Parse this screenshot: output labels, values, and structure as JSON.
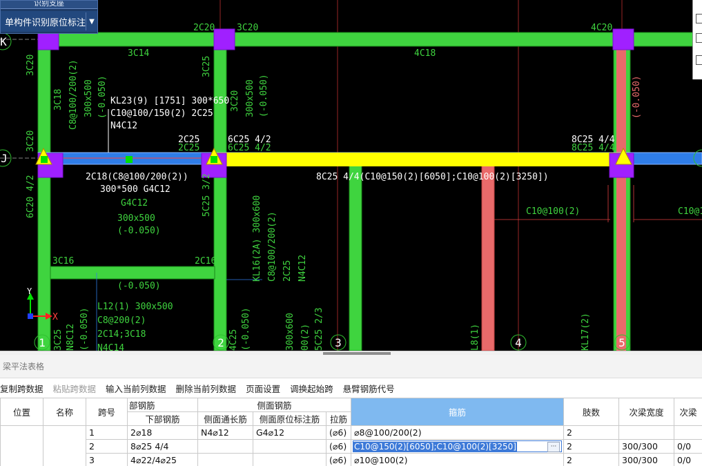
{
  "command_panel": {
    "top_label": "识别支座",
    "main_label": "单构件识别原位标注",
    "dropdown_icon": "chevron-down-icon"
  },
  "cad": {
    "axes": {
      "K": "K",
      "J": "J",
      "a1": "1",
      "a2": "2",
      "a3": "3",
      "a4": "4",
      "a5": "5"
    },
    "beam_info": {
      "line1": "KL23(9) [1751] 300*650",
      "line2": "C10@100/150(2) 2C25",
      "line3": "N4C12"
    },
    "labels": {
      "t_2c20": "2C20",
      "t_3c20": "3C20",
      "t_4c20": "4C20",
      "t_3c14": "3C14",
      "t_4c18": "4C18",
      "t_2c25_top": "2C25",
      "t_2c25_bot": "2C25",
      "t_6c25": "6C25 4/2",
      "t_6c25b": "6C25 4/2",
      "t_8c25": "8C25 4/4",
      "t_8c25b": "8C25 4/4",
      "t_orig_span1": "2C18(C8@100/200(2))",
      "t_size1": "300*500 G4C12",
      "t_orig_span2": "8C25 4/4(C10@150(2)[6050];C10@100(2)[3250])",
      "t_g4c12": "G4C12",
      "t_300x500": "300x500",
      "t_elev1": "(-0.050)",
      "t_3c16": "3C16",
      "t_2c16": "2C16",
      "t_elev2": "(-0.050)",
      "t_l12": "L12(1) 300x500",
      "t_c8at200": "C8@200(2)",
      "t_2c14": "2C14;3C18",
      "t_n4c14": "N4C14",
      "t_c10at100_1": "C10@100(2)",
      "t_c10at100_2": "C10@100(2",
      "t_v_3c18": "3C18",
      "t_v_c8": "C8@100/200(2)",
      "t_v_300x500": "300x500",
      "t_v_elev": "(-0.050)",
      "t_v_3c25": "3C25",
      "t_v_3c20": "3C20",
      "t_v_6c20": "6C20 4/2",
      "t_v_3c20b": "3C20",
      "t_v_300b": "300x500",
      "t_v_elevb": "(-0.050)",
      "t_v_elevc": "(-0.050)",
      "t_v_5c25": "5C25 3/2",
      "t_v_kl16": "KL16(2A) 300x600",
      "t_v_c8b": "C8@100/200(2)",
      "t_v_2c25": "2C25",
      "t_v_n4c12": "N4C12",
      "t_v_300x600": "300x600",
      "t_v_00_2": "00(2)",
      "t_v_5c25b": "5C25 2/3",
      "t_v_3c25b": "3C25",
      "t_v_n8c12": "N8C12",
      "t_v_elevd": "(-0.050)",
      "t_v_4c25": "4C25",
      "t_v_l8": "L8(1)",
      "t_v_kl17": "KL17(2)",
      "axis_x": "X",
      "axis_y": "Y"
    }
  },
  "panel": {
    "title": "梁平法表格",
    "toolbar": [
      {
        "label": "复制跨数据",
        "disabled": false
      },
      {
        "label": "粘贴跨数据",
        "disabled": true
      },
      {
        "label": "输入当前列数据",
        "disabled": false
      },
      {
        "label": "删除当前列数据",
        "disabled": false
      },
      {
        "label": "页面设置",
        "disabled": false
      },
      {
        "label": "调换起始跨",
        "disabled": false
      },
      {
        "label": "悬臂钢筋代号",
        "disabled": false
      }
    ],
    "headers": {
      "pos": "位置",
      "name": "名称",
      "span": "跨号",
      "group_bottom": "部钢筋",
      "bottom": "下部钢筋",
      "group_side": "侧面钢筋",
      "side_through": "侧面通长筋",
      "side_local": "侧面原位标注筋",
      "tie": "拉筋",
      "stirrup": "箍筋",
      "legs": "肢数",
      "sec_width": "次梁宽度",
      "sec_more": "次梁"
    },
    "rows": [
      {
        "span": "1",
        "bottom": "2⌀18",
        "side_through": "N4⌀12",
        "side_local": "G4⌀12",
        "tie": "(⌀6)",
        "stirrup": "⌀8@100/200(2)",
        "legs": "2",
        "sec_width": "",
        "sec_more": ""
      },
      {
        "span": "2",
        "bottom": "8⌀25 4/4",
        "side_through": "",
        "side_local": "",
        "tie": "(⌀6)",
        "stirrup": "C10@150(2)[6050];C10@100(2)[3250]",
        "legs": "2",
        "sec_width": "300/300",
        "sec_more": "0/0"
      },
      {
        "span": "3",
        "bottom": "4⌀22/4⌀25",
        "side_through": "",
        "side_local": "",
        "tie": "(⌀6)",
        "stirrup": "⌀10@100(2)",
        "legs": "2",
        "sec_width": "300/300",
        "sec_more": "0/0"
      }
    ],
    "colors": {
      "active_header": "#7fb9f0",
      "edit_border": "#3c79d8"
    }
  }
}
